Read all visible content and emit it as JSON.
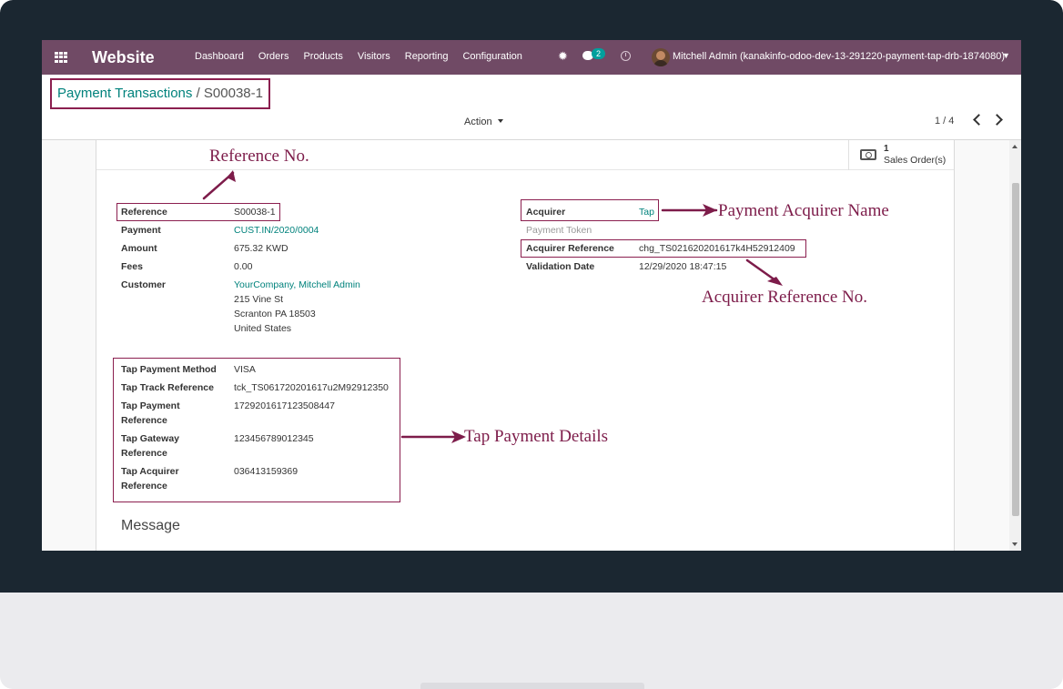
{
  "navbar": {
    "app_name": "Website",
    "menu": [
      "Dashboard",
      "Orders",
      "Products",
      "Visitors",
      "Reporting",
      "Configuration"
    ],
    "chat_badge": "2",
    "user": "Mitchell Admin (kanakinfo-odoo-dev-13-291220-payment-tap-drb-1874080)"
  },
  "breadcrumb": {
    "parent": "Payment Transactions",
    "separator": "/",
    "current": "S00038-1"
  },
  "control": {
    "action_label": "Action",
    "pager": "1 / 4"
  },
  "smart_button": {
    "count": "1",
    "label": "Sales Order(s)"
  },
  "left_fields": {
    "reference": {
      "label": "Reference",
      "value": "S00038-1"
    },
    "payment": {
      "label": "Payment",
      "value": "CUST.IN/2020/0004"
    },
    "amount": {
      "label": "Amount",
      "value": "675.32",
      "currency": "KWD"
    },
    "fees": {
      "label": "Fees",
      "value": "0.00"
    },
    "customer": {
      "label": "Customer",
      "name": "YourCompany, Mitchell Admin",
      "street": "215 Vine St",
      "city": "Scranton PA 18503",
      "country": "United States"
    }
  },
  "right_fields": {
    "acquirer": {
      "label": "Acquirer",
      "value": "Tap"
    },
    "payment_token": {
      "label": "Payment Token"
    },
    "acquirer_reference": {
      "label": "Acquirer Reference",
      "value": "chg_TS021620201617k4H52912409"
    },
    "validation_date": {
      "label": "Validation Date",
      "value": "12/29/2020 18:47:15"
    }
  },
  "tap_details": {
    "method": {
      "label": "Tap Payment Method",
      "value": "VISA"
    },
    "track_ref": {
      "label": "Tap Track Reference",
      "value": "tck_TS061720201617u2M92912350"
    },
    "payment_ref": {
      "label_1": "Tap Payment",
      "label_2": "Reference",
      "value": "1729201617123508447"
    },
    "gateway_ref": {
      "label_1": "Tap Gateway",
      "label_2": "Reference",
      "value": "123456789012345"
    },
    "acquirer_ref": {
      "label_1": "Tap Acquirer",
      "label_2": "Reference",
      "value": "036413159369"
    }
  },
  "message_heading": "Message",
  "annotations": {
    "reference_no": "Reference No.",
    "acquirer_name": "Payment Acquirer Name",
    "acquirer_reference_no": "Acquirer Reference No.",
    "tap_payment_details": "Tap Payment Details"
  },
  "colors": {
    "navbar": "#704a65",
    "link": "#00827c",
    "annotation": "#7d1c4a",
    "bezel": "#1b2731"
  }
}
